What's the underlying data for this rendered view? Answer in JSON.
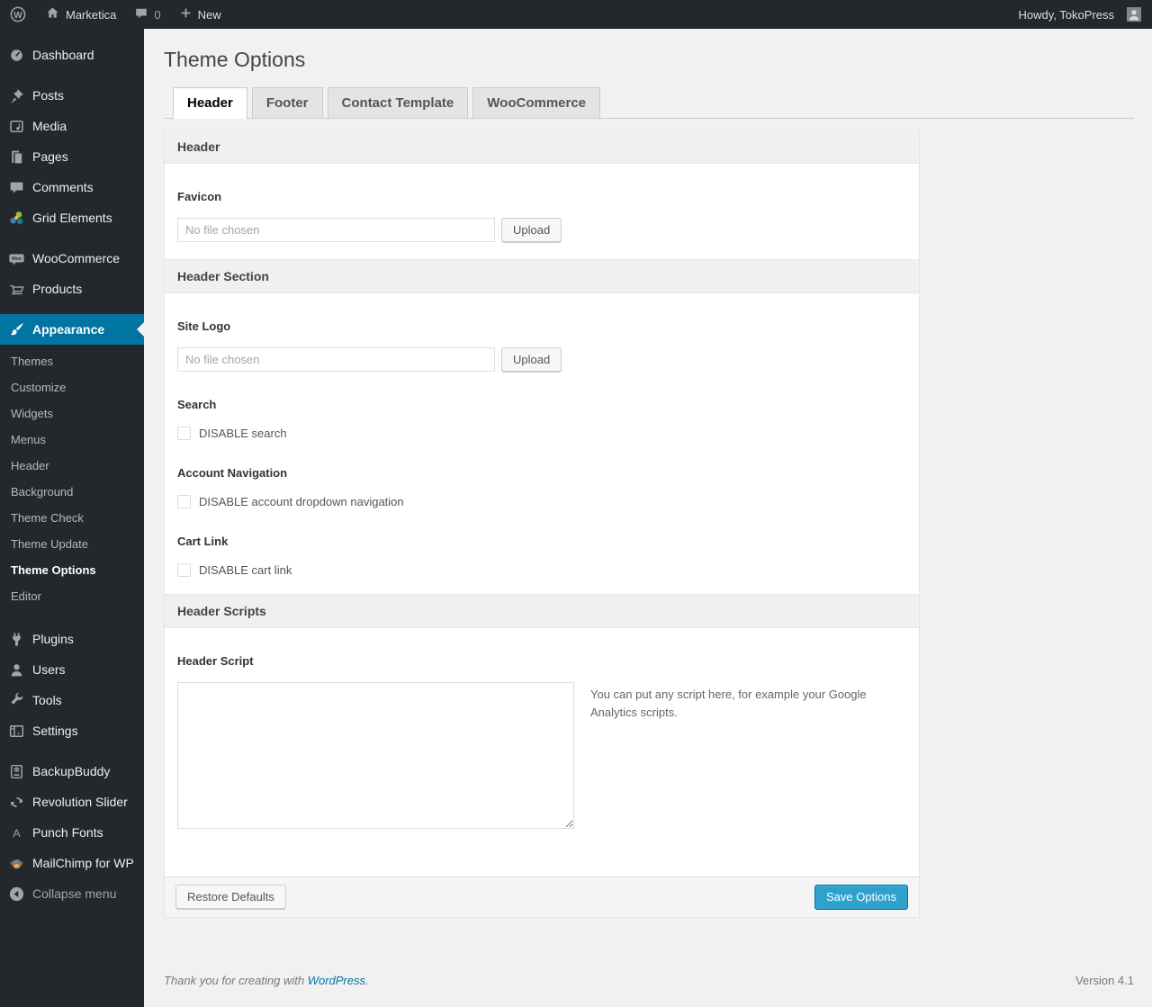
{
  "colors": {
    "admin_bar_bg": "#23282d",
    "menu_highlight": "#0074a2",
    "button_primary_bg": "#2ea2cc",
    "link": "#0074a2",
    "page_bg": "#f1f1f1"
  },
  "admin_bar": {
    "site_name": "Marketica",
    "comments_count": "0",
    "new_label": "New",
    "howdy": "Howdy, TokoPress"
  },
  "sidebar": {
    "dashboard": "Dashboard",
    "posts": "Posts",
    "media": "Media",
    "pages": "Pages",
    "comments": "Comments",
    "grid_elements": "Grid Elements",
    "woocommerce": "WooCommerce",
    "products": "Products",
    "appearance": "Appearance",
    "appearance_submenu": [
      "Themes",
      "Customize",
      "Widgets",
      "Menus",
      "Header",
      "Background",
      "Theme Check",
      "Theme Update",
      "Theme Options",
      "Editor"
    ],
    "current_submenu_item": "Theme Options",
    "plugins": "Plugins",
    "users": "Users",
    "tools": "Tools",
    "settings": "Settings",
    "backupbuddy": "BackupBuddy",
    "revolution_slider": "Revolution Slider",
    "punch_fonts": "Punch Fonts",
    "mailchimp": "MailChimp for WP",
    "collapse_menu": "Collapse menu"
  },
  "page": {
    "title": "Theme Options",
    "tabs": [
      "Header",
      "Footer",
      "Contact Template",
      "WooCommerce"
    ],
    "active_tab": "Header"
  },
  "panel": {
    "sections": {
      "header": "Header",
      "header_section": "Header Section",
      "header_scripts": "Header Scripts"
    },
    "favicon": {
      "label": "Favicon",
      "file_value": "No file chosen",
      "upload_label": "Upload"
    },
    "site_logo": {
      "label": "Site Logo",
      "file_value": "No file chosen",
      "upload_label": "Upload"
    },
    "search": {
      "label": "Search",
      "checkbox_label": "DISABLE search",
      "checked": false
    },
    "account_navigation": {
      "label": "Account Navigation",
      "checkbox_label": "DISABLE account dropdown navigation",
      "checked": false
    },
    "cart_link": {
      "label": "Cart Link",
      "checkbox_label": "DISABLE cart link",
      "checked": false
    },
    "header_script": {
      "label": "Header Script",
      "value": "",
      "note": "You can put any script here, for example your Google Analytics scripts."
    },
    "actions": {
      "restore_label": "Restore Defaults",
      "save_label": "Save Options"
    }
  },
  "footer": {
    "thanks_prefix": "Thank you for creating with ",
    "wordpress_link": "WordPress",
    "suffix": ".",
    "version": "Version 4.1"
  }
}
